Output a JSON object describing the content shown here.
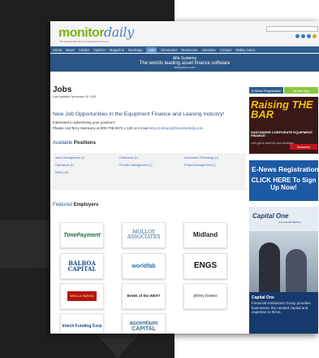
{
  "site": {
    "logo_main": "monitor",
    "logo_daily": "daily",
    "tagline": "The Independent Voice of Equipment Finance"
  },
  "nav": [
    "Home",
    "News",
    "Articles",
    "Opinion",
    "Magazine",
    "Rankings",
    "Jobs",
    "Directories",
    "Resources",
    "Advertise",
    "Contact",
    "Molley Assoc"
  ],
  "banner": {
    "line1": "Alfa Systems",
    "line2": "The worlds leading asset finance software",
    "line3": "alfasystems.com"
  },
  "page": {
    "title": "Jobs",
    "updated": "Last Updated: November 30, 2018",
    "headline": "New Job Opportunities in the Equipment Finance and Leasing Industry!",
    "intro1": "Interested in advertising your position?",
    "intro2_prefix": "Please call Terry Mulreany at 800.708.9373 x 130 or e-mail ",
    "intro2_email": "terry.mulreany@monitordaily.com",
    "available_prefix": "Available ",
    "available_bold": "Positions",
    "featured_prefix": "Featured ",
    "featured_bold": "Employers"
  },
  "positions": [
    "Asset Management (1)",
    "Collections (1)",
    "Information Technology (1)",
    "Operations (1)",
    "Portfolio Management (1)",
    "Project Management (1)",
    "Sales (14)"
  ],
  "employers": [
    "TimePayment",
    "MOLLOY ASSOCIATES",
    "Midland",
    "BALBOA CAPITAL",
    "worldfab",
    "ENGS",
    "WELLS FARGO",
    "BANK of the WEST",
    "pitney bowes",
    "Intech Funding Corp",
    "ascentium CAPITAL"
  ],
  "sidebar": {
    "tab_left": "E-News Registration",
    "tab_right": "Mobile App",
    "ad1_title": "Raising THE BAR",
    "ad1_sub": "SANTANDER CORPORATE EQUIPMENT FINANCE",
    "ad1_small": "Let's get to work for your business",
    "ad1_brand": "Santander",
    "ad2_title": "E-News Registration",
    "ad2_cta": "CLICK HERE To Sign Up Now!",
    "ad3_brand": "Capital One",
    "ad3_sub": "Commercial Banking",
    "ad3_heading": "Capital One",
    "ad3_body": "Financial Institutions Group provides businesses the needed capital and expertise to thrive."
  },
  "colors": {
    "nav": "#2f5d8c",
    "accent_green": "#8cc63f",
    "link": "#3b6db0"
  }
}
